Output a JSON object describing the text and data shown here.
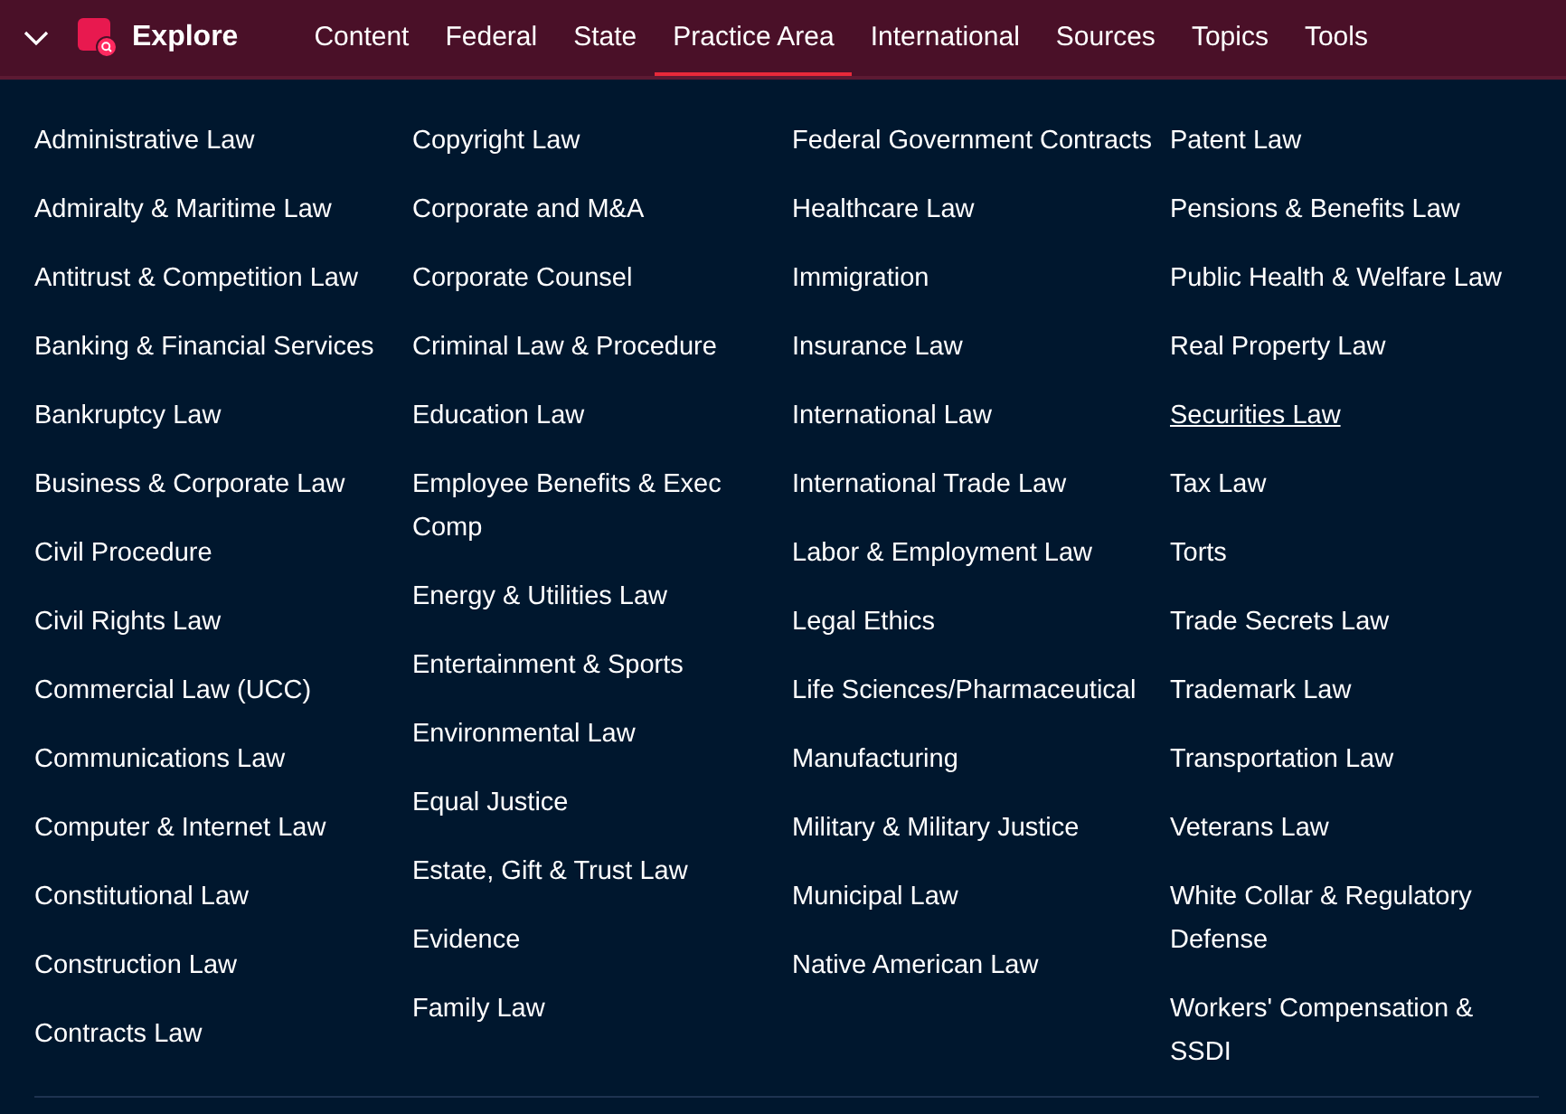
{
  "header": {
    "brand": "Explore",
    "nav": [
      {
        "label": "Content",
        "selected": false
      },
      {
        "label": "Federal",
        "selected": false
      },
      {
        "label": "State",
        "selected": false
      },
      {
        "label": "Practice Area",
        "selected": true
      },
      {
        "label": "International",
        "selected": false
      },
      {
        "label": "Sources",
        "selected": false
      },
      {
        "label": "Topics",
        "selected": false
      },
      {
        "label": "Tools",
        "selected": false
      }
    ]
  },
  "columns": [
    [
      {
        "label": "Administrative Law",
        "hovered": false
      },
      {
        "label": "Admiralty & Maritime Law",
        "hovered": false
      },
      {
        "label": "Antitrust & Competition Law",
        "hovered": false
      },
      {
        "label": "Banking & Financial Services",
        "hovered": false
      },
      {
        "label": "Bankruptcy Law",
        "hovered": false
      },
      {
        "label": "Business & Corporate Law",
        "hovered": false
      },
      {
        "label": "Civil Procedure",
        "hovered": false
      },
      {
        "label": "Civil Rights Law",
        "hovered": false
      },
      {
        "label": "Commercial Law (UCC)",
        "hovered": false
      },
      {
        "label": "Communications Law",
        "hovered": false
      },
      {
        "label": "Computer & Internet Law",
        "hovered": false
      },
      {
        "label": "Constitutional Law",
        "hovered": false
      },
      {
        "label": "Construction Law",
        "hovered": false
      },
      {
        "label": "Contracts Law",
        "hovered": false
      }
    ],
    [
      {
        "label": "Copyright Law",
        "hovered": false
      },
      {
        "label": "Corporate and M&A",
        "hovered": false
      },
      {
        "label": "Corporate Counsel",
        "hovered": false
      },
      {
        "label": "Criminal Law & Procedure",
        "hovered": false
      },
      {
        "label": "Education Law",
        "hovered": false
      },
      {
        "label": "Employee Benefits & Exec Comp",
        "hovered": false
      },
      {
        "label": "Energy & Utilities Law",
        "hovered": false
      },
      {
        "label": "Entertainment & Sports",
        "hovered": false
      },
      {
        "label": "Environmental Law",
        "hovered": false
      },
      {
        "label": "Equal Justice",
        "hovered": false
      },
      {
        "label": "Estate, Gift & Trust Law",
        "hovered": false
      },
      {
        "label": "Evidence",
        "hovered": false
      },
      {
        "label": "Family Law",
        "hovered": false
      }
    ],
    [
      {
        "label": "Federal Government Contracts",
        "hovered": false
      },
      {
        "label": "Healthcare Law",
        "hovered": false
      },
      {
        "label": "Immigration",
        "hovered": false
      },
      {
        "label": "Insurance Law",
        "hovered": false
      },
      {
        "label": "International Law",
        "hovered": false
      },
      {
        "label": "International Trade Law",
        "hovered": false
      },
      {
        "label": "Labor & Employment Law",
        "hovered": false
      },
      {
        "label": "Legal Ethics",
        "hovered": false
      },
      {
        "label": "Life Sciences/Pharmaceutical",
        "hovered": false
      },
      {
        "label": "Manufacturing",
        "hovered": false
      },
      {
        "label": "Military & Military Justice",
        "hovered": false
      },
      {
        "label": "Municipal Law",
        "hovered": false
      },
      {
        "label": "Native American Law",
        "hovered": false
      }
    ],
    [
      {
        "label": "Patent Law",
        "hovered": false
      },
      {
        "label": "Pensions & Benefits Law",
        "hovered": false
      },
      {
        "label": "Public Health & Welfare Law",
        "hovered": false
      },
      {
        "label": "Real Property Law",
        "hovered": false
      },
      {
        "label": "Securities Law",
        "hovered": true
      },
      {
        "label": "Tax Law",
        "hovered": false
      },
      {
        "label": "Torts",
        "hovered": false
      },
      {
        "label": "Trade Secrets Law",
        "hovered": false
      },
      {
        "label": "Trademark Law",
        "hovered": false
      },
      {
        "label": "Transportation Law",
        "hovered": false
      },
      {
        "label": "Veterans Law",
        "hovered": false
      },
      {
        "label": "White Collar & Regulatory Defense",
        "hovered": false
      },
      {
        "label": "Workers' Compensation & SSDI",
        "hovered": false
      }
    ]
  ]
}
